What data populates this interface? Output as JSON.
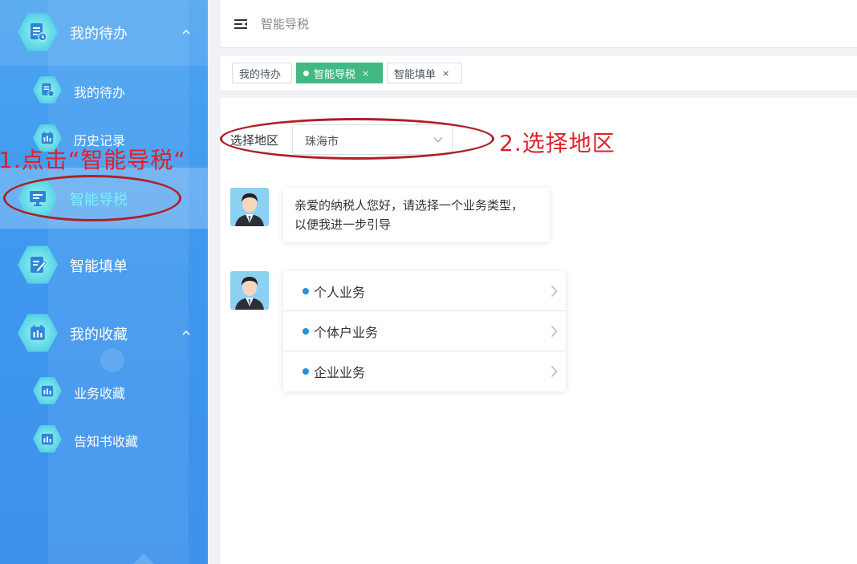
{
  "sidebar": {
    "items": [
      {
        "label": "我的待办",
        "level": "top",
        "icon": "task-doc-icon",
        "expanded": true
      },
      {
        "label": "我的待办",
        "level": "sub",
        "icon": "task-doc-icon"
      },
      {
        "label": "历史记录",
        "level": "sub",
        "icon": "calendar-icon"
      },
      {
        "label": "智能导税",
        "level": "top",
        "icon": "monitor-icon",
        "active": true
      },
      {
        "label": "智能填单",
        "level": "top",
        "icon": "edit-form-icon"
      },
      {
        "label": "我的收藏",
        "level": "top",
        "icon": "calendar-icon",
        "expanded": true
      },
      {
        "label": "业务收藏",
        "level": "sub",
        "icon": "calendar-icon"
      },
      {
        "label": "告知书收藏",
        "level": "sub",
        "icon": "calendar-icon"
      }
    ]
  },
  "header": {
    "breadcrumb": "智能导税"
  },
  "tabs": [
    {
      "label": "我的待办",
      "active": false,
      "closable": false
    },
    {
      "label": "智能导税",
      "active": true,
      "closable": true,
      "close_glyph": "×"
    },
    {
      "label": "智能填单",
      "active": false,
      "closable": true,
      "close_glyph": "×"
    }
  ],
  "region": {
    "label": "选择地区",
    "value": "珠海市"
  },
  "chat": {
    "greeting_line1": "亲爱的纳税人您好，请选择一个业务类型，",
    "greeting_line2": "以便我进一步引导",
    "options": [
      "个人业务",
      "个体户业务",
      "企业业务"
    ]
  },
  "annotations": {
    "step1": "1.点击“智能导税“",
    "step2": "2.选择地区",
    "color": "#e0202a"
  },
  "colors": {
    "sidebar_bg": "#3f97ee",
    "active_tab": "#42b983",
    "active_menu_text": "#7cf0ff",
    "bullet": "#2b8fd6"
  }
}
